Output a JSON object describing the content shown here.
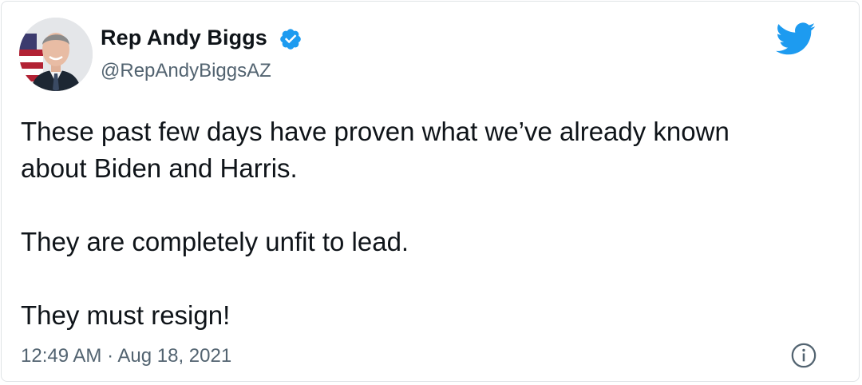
{
  "author": {
    "name": "Rep Andy Biggs",
    "handle": "@RepAndyBiggsAZ",
    "verified": true,
    "avatar_icon": "profile-photo"
  },
  "tweet": {
    "paragraphs": [
      "These past few days have proven what we’ve already known about Biden and Harris.",
      "They are completely unfit to lead.",
      "They must resign!"
    ],
    "timestamp": "12:49 AM · Aug 18, 2021"
  },
  "icons": {
    "brand": "twitter-bird-icon",
    "verified": "verified-badge-icon",
    "info": "info-icon"
  },
  "colors": {
    "brand_blue": "#1d9bf0",
    "text_primary": "#0f1419",
    "text_secondary": "#536471",
    "border": "#dfe3e6"
  }
}
